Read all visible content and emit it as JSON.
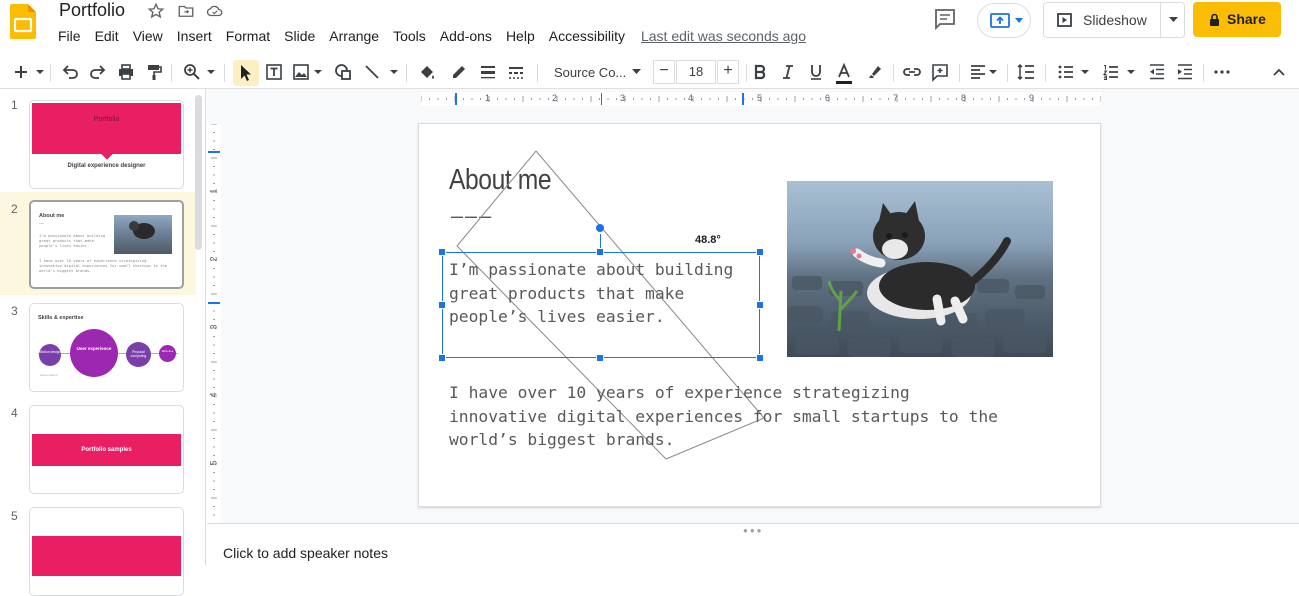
{
  "doc": {
    "title": "Portfolio"
  },
  "menu": {
    "items": [
      "File",
      "Edit",
      "View",
      "Insert",
      "Format",
      "Slide",
      "Arrange",
      "Tools",
      "Add-ons",
      "Help",
      "Accessibility"
    ],
    "last_edit": "Last edit was seconds ago"
  },
  "actions": {
    "slideshow": "Slideshow",
    "share": "Share"
  },
  "toolbar": {
    "font": "Source Co...",
    "font_size": "18",
    "minus": "−",
    "plus": "+"
  },
  "filmstrip": {
    "slides": [
      {
        "num": "1",
        "title": "Portfolio",
        "subtitle": "Digital experience designer"
      },
      {
        "num": "2",
        "title": "About me",
        "line1": "I'm passionate about building great products that make people's lives easier.",
        "line2": "I have over 10 years of experience strategizing innovative digital experiences for small startups to the world's biggest brands."
      },
      {
        "num": "3",
        "title": "Skills & expertise",
        "c1": "Motion design",
        "c2": "User experience",
        "c3": "Physical computing",
        "c4": "Web dev",
        "tiny": "Lorem ipsum"
      },
      {
        "num": "4",
        "title": "Portfolio samples"
      },
      {
        "num": "5"
      }
    ]
  },
  "ruler": {
    "h": [
      "1",
      "2",
      "3",
      "4",
      "5",
      "6",
      "7",
      "8",
      "9"
    ],
    "v": [
      "1",
      "2",
      "3",
      "4",
      "5"
    ]
  },
  "slide": {
    "title": "About me",
    "dash": "———",
    "text1": "I’m passionate about building\ngreat products that make\npeople’s lives easier.",
    "text2": "I have over 10 years of experience strategizing\ninnovative digital experiences for small startups to the\nworld’s biggest brands.",
    "angle": "48.8°"
  },
  "notes": {
    "placeholder": "Click to add speaker notes"
  },
  "colors": {
    "brand_yellow": "#fbbc04",
    "accent_pink": "#e91e63",
    "purple": "#9c27b0",
    "selection_blue": "#1a73e8"
  }
}
